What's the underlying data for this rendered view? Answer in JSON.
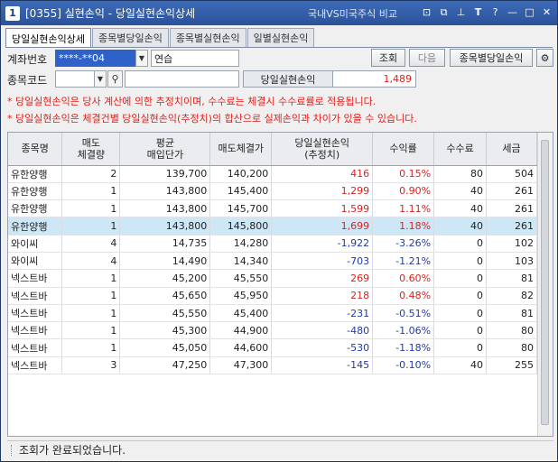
{
  "window": {
    "number": "1",
    "title": "[0355] 실현손익 - 당일실현손익상세",
    "link": "국내VS미국주식 비교"
  },
  "tabs": [
    {
      "label": "당일실현손익상세",
      "active": true
    },
    {
      "label": "종목별당일손익",
      "active": false
    },
    {
      "label": "종목별실현손익",
      "active": false
    },
    {
      "label": "일별실현손익",
      "active": false
    }
  ],
  "form": {
    "account_label": "계좌번호",
    "account_value": "****-**04",
    "account_name": "연습",
    "code_label": "종목코드",
    "code_value": "",
    "code_name": "",
    "pl_label": "당일실현손익",
    "pl_value": "1,489"
  },
  "buttons": {
    "query": "조회",
    "next": "다음",
    "by_item": "종목별당일손익"
  },
  "notes": [
    "* 당일실현손익은 당사 계산에 의한 추정치이며, 수수료는 체결시 수수료률로 적용됩니다.",
    "* 당일실현손익은 체결건별 당일실현손익(추정치)의 합산으로 실제손익과 차이가 있을 수 있습니다."
  ],
  "table": {
    "headers": [
      [
        "종목명"
      ],
      [
        "매도",
        "체결량"
      ],
      [
        "평균",
        "매입단가"
      ],
      [
        "매도체결가"
      ],
      [
        "당일실현손익",
        "(추정치)"
      ],
      [
        "수익률"
      ],
      [
        "수수료"
      ],
      [
        "세금"
      ]
    ],
    "rows": [
      {
        "name": "유한양행",
        "qty": "2",
        "avg": "139,700",
        "sell": "140,200",
        "pl": "416",
        "rate": "0.15%",
        "fee": "80",
        "tax": "504",
        "sign": "pos",
        "highlight": false
      },
      {
        "name": "유한양행",
        "qty": "1",
        "avg": "143,800",
        "sell": "145,400",
        "pl": "1,299",
        "rate": "0.90%",
        "fee": "40",
        "tax": "261",
        "sign": "pos",
        "highlight": false
      },
      {
        "name": "유한양행",
        "qty": "1",
        "avg": "143,800",
        "sell": "145,700",
        "pl": "1,599",
        "rate": "1.11%",
        "fee": "40",
        "tax": "261",
        "sign": "pos",
        "highlight": false
      },
      {
        "name": "유한양행",
        "qty": "1",
        "avg": "143,800",
        "sell": "145,800",
        "pl": "1,699",
        "rate": "1.18%",
        "fee": "40",
        "tax": "261",
        "sign": "pos",
        "highlight": true
      },
      {
        "name": "와이씨",
        "qty": "4",
        "avg": "14,735",
        "sell": "14,280",
        "pl": "-1,922",
        "rate": "-3.26%",
        "fee": "0",
        "tax": "102",
        "sign": "neg",
        "highlight": false
      },
      {
        "name": "와이씨",
        "qty": "4",
        "avg": "14,490",
        "sell": "14,340",
        "pl": "-703",
        "rate": "-1.21%",
        "fee": "0",
        "tax": "103",
        "sign": "neg",
        "highlight": false
      },
      {
        "name": "넥스트바",
        "qty": "1",
        "avg": "45,200",
        "sell": "45,550",
        "pl": "269",
        "rate": "0.60%",
        "fee": "0",
        "tax": "81",
        "sign": "pos",
        "highlight": false
      },
      {
        "name": "넥스트바",
        "qty": "1",
        "avg": "45,650",
        "sell": "45,950",
        "pl": "218",
        "rate": "0.48%",
        "fee": "0",
        "tax": "82",
        "sign": "pos",
        "highlight": false
      },
      {
        "name": "넥스트바",
        "qty": "1",
        "avg": "45,550",
        "sell": "45,400",
        "pl": "-231",
        "rate": "-0.51%",
        "fee": "0",
        "tax": "81",
        "sign": "neg",
        "highlight": false
      },
      {
        "name": "넥스트바",
        "qty": "1",
        "avg": "45,300",
        "sell": "44,900",
        "pl": "-480",
        "rate": "-1.06%",
        "fee": "0",
        "tax": "80",
        "sign": "neg",
        "highlight": false
      },
      {
        "name": "넥스트바",
        "qty": "1",
        "avg": "45,050",
        "sell": "44,600",
        "pl": "-530",
        "rate": "-1.18%",
        "fee": "0",
        "tax": "80",
        "sign": "neg",
        "highlight": false
      },
      {
        "name": "넥스트바",
        "qty": "3",
        "avg": "47,250",
        "sell": "47,300",
        "pl": "-145",
        "rate": "-0.10%",
        "fee": "40",
        "tax": "255",
        "sign": "neg",
        "highlight": false
      }
    ]
  },
  "status": "조회가 완료되었습니다.",
  "colors": {
    "positive": "#e0201c",
    "negative": "#2238b0",
    "titlebar": "#2b5299",
    "highlight_row": "#cde7f7"
  }
}
